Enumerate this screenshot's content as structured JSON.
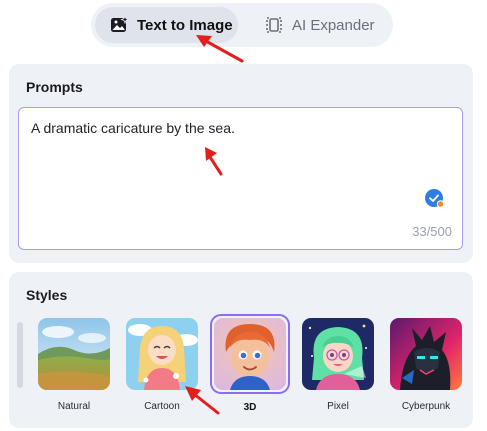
{
  "tabs": [
    {
      "label": "Text to Image",
      "icon": "image-sparkle-icon",
      "active": true
    },
    {
      "label": "AI Expander",
      "icon": "expand-frame-icon",
      "active": false
    }
  ],
  "prompts": {
    "title": "Prompts",
    "value": "A dramatic caricature by the sea.",
    "counter": "33/500"
  },
  "styles": {
    "title": "Styles",
    "items": [
      {
        "label": "Natural",
        "selected": false
      },
      {
        "label": "Cartoon",
        "selected": false
      },
      {
        "label": "3D",
        "selected": true
      },
      {
        "label": "Pixel",
        "selected": false
      },
      {
        "label": "Cyberpunk",
        "selected": false
      }
    ]
  },
  "colors": {
    "accent": "#8b6cf2",
    "panel_bg": "#eef1f6",
    "check_blue": "#2f7de1",
    "annotation_red": "#e0201c"
  }
}
